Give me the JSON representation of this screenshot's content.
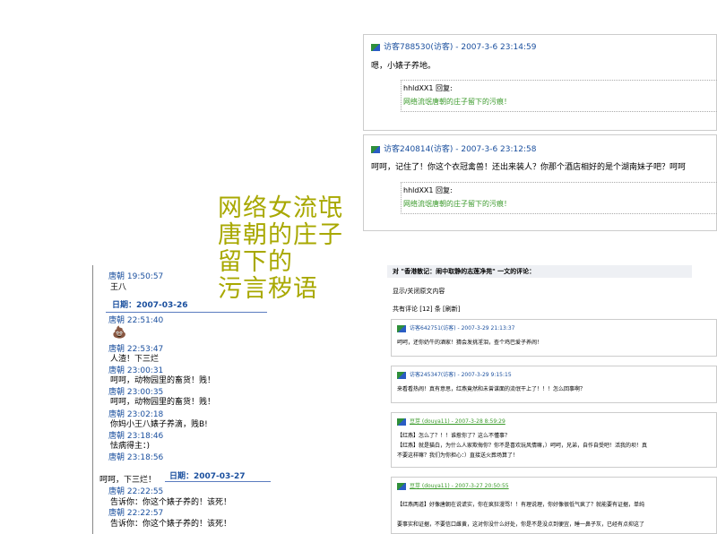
{
  "top_panel": {
    "c1": {
      "header": "访客788530(访客)  -  2007-3-6 23:14:59",
      "body": "嗯，小婊子养地。",
      "reply_label": "hhldXX1 回复:",
      "reply_text": "网络流氓唐朝的庄子留下的污痕！"
    },
    "c2": {
      "header": "访客240814(访客)  -  2007-3-6 23:12:58",
      "body": "呵呵，记住了！你这个衣冠禽兽！还出来装人？你那个酒店相好的是个湖南妹子吧？呵呵",
      "reply_label": "hhldXX1 回复:",
      "reply_text": "网络流氓唐朝的庄子留下的污痕！"
    }
  },
  "title_lines": [
    "网络女流氓",
    "唐朝的庄子",
    "留下的",
    "污言秽语"
  ],
  "chat": {
    "lines": [
      {
        "k": "name",
        "t": "唐朝 19:50:57"
      },
      {
        "k": "msg",
        "t": "王八"
      },
      {
        "k": "date",
        "t": "日期：2007-03-26"
      },
      {
        "k": "name",
        "t": "唐朝   22:51:40"
      },
      {
        "k": "name",
        "t": "唐朝   22:53:47"
      },
      {
        "k": "msg",
        "t": "人渣！下三烂"
      },
      {
        "k": "name",
        "t": "唐朝   23:00:31"
      },
      {
        "k": "msg",
        "t": "呵呵，动物园里的畜货！贱！"
      },
      {
        "k": "name",
        "t": "唐朝   23:00:35"
      },
      {
        "k": "msg",
        "t": "呵呵，动物园里的畜货！贱！"
      },
      {
        "k": "name",
        "t": "唐朝   23:02:18"
      },
      {
        "k": "msg",
        "t": "你妈小王八婊子养滴，贱B!"
      },
      {
        "k": "name",
        "t": "唐朝   23:18:46"
      },
      {
        "k": "msg",
        "t": "怯病得主：)"
      },
      {
        "k": "name",
        "t": "唐朝   23:18:56"
      },
      {
        "k": "msg",
        "t": "呵呵，下三烂！"
      },
      {
        "k": "date",
        "t": "日期：2007-03-27"
      },
      {
        "k": "name",
        "t": "唐朝   22:22:55"
      },
      {
        "k": "msg",
        "t": "告诉你：你这个婊子养的！该死！"
      },
      {
        "k": "name",
        "t": "唐朝   22:22:57"
      },
      {
        "k": "msg",
        "t": "告诉你：你这个婊子养的！该死！"
      }
    ]
  },
  "bottom_panel": {
    "heading": "对  \"香港散记：闹中取静的志莲净苑\"  一文的评论：",
    "toggle": "显示/关闭原文内容",
    "count": "共有评论 [12] 条    [刷新]",
    "comments": [
      {
        "header": "访客642751(访客)  -  2007-3-29 21:13:37",
        "body": "呵呵，还你奶牛的酒家！猜会发挑淫泪，查个鸡巴爱子养闹！"
      },
      {
        "header": "访客245347(访客)  -  2007-3-29 9:15:15",
        "body": "来看看热闹！真有意思，红燕竟然和未曾谋面的流氓干上了！！！怎么回事啊？"
      },
      {
        "header": "豆芽 (douya11)  -  2007-3-28 8:59:29",
        "body": "【红燕】怎么了？！！谁惹你了？这么不懂事？\n【红燕】就是猫白，为什么人家欺侮你？你不是喜欢玩风情嘛，）呵呵，兄弟，自作自受吧！活我的坝！真\n不要这样嘛？我们为你担心：）直接送火葬场算了！"
      },
      {
        "header": "豆芽 (douya11)  -  2007-3-27 20:50:55",
        "body": "【红燕两道】好像唐朝在说谎实，你在疯狂漫骂！！有理说理，你好像很低气疯了？就能要有证据，单纯\n要事实和证据，不要信口雌黄，这对你没什么好处，你是不是没点到便宜，睡一鼻子灰，已经有点抑这了"
      }
    ]
  }
}
